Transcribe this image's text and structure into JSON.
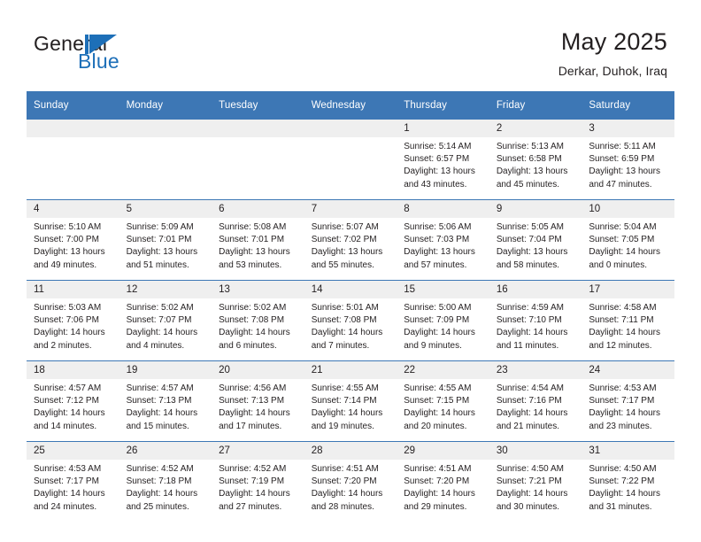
{
  "logo": {
    "word1": "General",
    "word2": "Blue",
    "flag_icon": "blue-flag-triangle",
    "accent_color": "#1d6fb8"
  },
  "header": {
    "title": "May 2025",
    "location": "Derkar, Duhok, Iraq"
  },
  "theme": {
    "header_blue": "#3d77b5",
    "daynum_band": "#efefef",
    "text": "#231f20",
    "page_background": "#ffffff"
  },
  "calendar": {
    "weekday_headers": [
      "Sunday",
      "Monday",
      "Tuesday",
      "Wednesday",
      "Thursday",
      "Friday",
      "Saturday"
    ],
    "weeks": [
      [
        {
          "day": "",
          "empty": true
        },
        {
          "day": "",
          "empty": true
        },
        {
          "day": "",
          "empty": true
        },
        {
          "day": "",
          "empty": true
        },
        {
          "day": "1",
          "sunrise": "Sunrise: 5:14 AM",
          "sunset": "Sunset: 6:57 PM",
          "daylight_1": "Daylight: 13 hours",
          "daylight_2": "and 43 minutes."
        },
        {
          "day": "2",
          "sunrise": "Sunrise: 5:13 AM",
          "sunset": "Sunset: 6:58 PM",
          "daylight_1": "Daylight: 13 hours",
          "daylight_2": "and 45 minutes."
        },
        {
          "day": "3",
          "sunrise": "Sunrise: 5:11 AM",
          "sunset": "Sunset: 6:59 PM",
          "daylight_1": "Daylight: 13 hours",
          "daylight_2": "and 47 minutes."
        }
      ],
      [
        {
          "day": "4",
          "sunrise": "Sunrise: 5:10 AM",
          "sunset": "Sunset: 7:00 PM",
          "daylight_1": "Daylight: 13 hours",
          "daylight_2": "and 49 minutes."
        },
        {
          "day": "5",
          "sunrise": "Sunrise: 5:09 AM",
          "sunset": "Sunset: 7:01 PM",
          "daylight_1": "Daylight: 13 hours",
          "daylight_2": "and 51 minutes."
        },
        {
          "day": "6",
          "sunrise": "Sunrise: 5:08 AM",
          "sunset": "Sunset: 7:01 PM",
          "daylight_1": "Daylight: 13 hours",
          "daylight_2": "and 53 minutes."
        },
        {
          "day": "7",
          "sunrise": "Sunrise: 5:07 AM",
          "sunset": "Sunset: 7:02 PM",
          "daylight_1": "Daylight: 13 hours",
          "daylight_2": "and 55 minutes."
        },
        {
          "day": "8",
          "sunrise": "Sunrise: 5:06 AM",
          "sunset": "Sunset: 7:03 PM",
          "daylight_1": "Daylight: 13 hours",
          "daylight_2": "and 57 minutes."
        },
        {
          "day": "9",
          "sunrise": "Sunrise: 5:05 AM",
          "sunset": "Sunset: 7:04 PM",
          "daylight_1": "Daylight: 13 hours",
          "daylight_2": "and 58 minutes."
        },
        {
          "day": "10",
          "sunrise": "Sunrise: 5:04 AM",
          "sunset": "Sunset: 7:05 PM",
          "daylight_1": "Daylight: 14 hours",
          "daylight_2": "and 0 minutes."
        }
      ],
      [
        {
          "day": "11",
          "sunrise": "Sunrise: 5:03 AM",
          "sunset": "Sunset: 7:06 PM",
          "daylight_1": "Daylight: 14 hours",
          "daylight_2": "and 2 minutes."
        },
        {
          "day": "12",
          "sunrise": "Sunrise: 5:02 AM",
          "sunset": "Sunset: 7:07 PM",
          "daylight_1": "Daylight: 14 hours",
          "daylight_2": "and 4 minutes."
        },
        {
          "day": "13",
          "sunrise": "Sunrise: 5:02 AM",
          "sunset": "Sunset: 7:08 PM",
          "daylight_1": "Daylight: 14 hours",
          "daylight_2": "and 6 minutes."
        },
        {
          "day": "14",
          "sunrise": "Sunrise: 5:01 AM",
          "sunset": "Sunset: 7:08 PM",
          "daylight_1": "Daylight: 14 hours",
          "daylight_2": "and 7 minutes."
        },
        {
          "day": "15",
          "sunrise": "Sunrise: 5:00 AM",
          "sunset": "Sunset: 7:09 PM",
          "daylight_1": "Daylight: 14 hours",
          "daylight_2": "and 9 minutes."
        },
        {
          "day": "16",
          "sunrise": "Sunrise: 4:59 AM",
          "sunset": "Sunset: 7:10 PM",
          "daylight_1": "Daylight: 14 hours",
          "daylight_2": "and 11 minutes."
        },
        {
          "day": "17",
          "sunrise": "Sunrise: 4:58 AM",
          "sunset": "Sunset: 7:11 PM",
          "daylight_1": "Daylight: 14 hours",
          "daylight_2": "and 12 minutes."
        }
      ],
      [
        {
          "day": "18",
          "sunrise": "Sunrise: 4:57 AM",
          "sunset": "Sunset: 7:12 PM",
          "daylight_1": "Daylight: 14 hours",
          "daylight_2": "and 14 minutes."
        },
        {
          "day": "19",
          "sunrise": "Sunrise: 4:57 AM",
          "sunset": "Sunset: 7:13 PM",
          "daylight_1": "Daylight: 14 hours",
          "daylight_2": "and 15 minutes."
        },
        {
          "day": "20",
          "sunrise": "Sunrise: 4:56 AM",
          "sunset": "Sunset: 7:13 PM",
          "daylight_1": "Daylight: 14 hours",
          "daylight_2": "and 17 minutes."
        },
        {
          "day": "21",
          "sunrise": "Sunrise: 4:55 AM",
          "sunset": "Sunset: 7:14 PM",
          "daylight_1": "Daylight: 14 hours",
          "daylight_2": "and 19 minutes."
        },
        {
          "day": "22",
          "sunrise": "Sunrise: 4:55 AM",
          "sunset": "Sunset: 7:15 PM",
          "daylight_1": "Daylight: 14 hours",
          "daylight_2": "and 20 minutes."
        },
        {
          "day": "23",
          "sunrise": "Sunrise: 4:54 AM",
          "sunset": "Sunset: 7:16 PM",
          "daylight_1": "Daylight: 14 hours",
          "daylight_2": "and 21 minutes."
        },
        {
          "day": "24",
          "sunrise": "Sunrise: 4:53 AM",
          "sunset": "Sunset: 7:17 PM",
          "daylight_1": "Daylight: 14 hours",
          "daylight_2": "and 23 minutes."
        }
      ],
      [
        {
          "day": "25",
          "sunrise": "Sunrise: 4:53 AM",
          "sunset": "Sunset: 7:17 PM",
          "daylight_1": "Daylight: 14 hours",
          "daylight_2": "and 24 minutes."
        },
        {
          "day": "26",
          "sunrise": "Sunrise: 4:52 AM",
          "sunset": "Sunset: 7:18 PM",
          "daylight_1": "Daylight: 14 hours",
          "daylight_2": "and 25 minutes."
        },
        {
          "day": "27",
          "sunrise": "Sunrise: 4:52 AM",
          "sunset": "Sunset: 7:19 PM",
          "daylight_1": "Daylight: 14 hours",
          "daylight_2": "and 27 minutes."
        },
        {
          "day": "28",
          "sunrise": "Sunrise: 4:51 AM",
          "sunset": "Sunset: 7:20 PM",
          "daylight_1": "Daylight: 14 hours",
          "daylight_2": "and 28 minutes."
        },
        {
          "day": "29",
          "sunrise": "Sunrise: 4:51 AM",
          "sunset": "Sunset: 7:20 PM",
          "daylight_1": "Daylight: 14 hours",
          "daylight_2": "and 29 minutes."
        },
        {
          "day": "30",
          "sunrise": "Sunrise: 4:50 AM",
          "sunset": "Sunset: 7:21 PM",
          "daylight_1": "Daylight: 14 hours",
          "daylight_2": "and 30 minutes."
        },
        {
          "day": "31",
          "sunrise": "Sunrise: 4:50 AM",
          "sunset": "Sunset: 7:22 PM",
          "daylight_1": "Daylight: 14 hours",
          "daylight_2": "and 31 minutes."
        }
      ]
    ]
  }
}
